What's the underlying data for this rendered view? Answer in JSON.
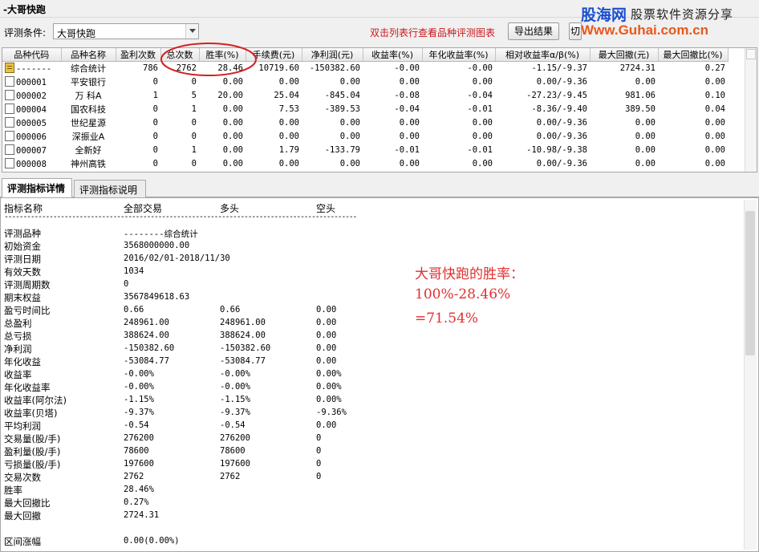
{
  "window": {
    "title": "-大哥快跑"
  },
  "watermark": {
    "brand": "股海网",
    "slogan": "股票软件资源分享",
    "url": "Www.Guhai.com.cn"
  },
  "toolbar": {
    "condition_label": "评测条件:",
    "condition_value": "大哥快跑",
    "hint": "双击列表行查看品种评测图表",
    "export_label": "导出结果",
    "extra_label": "切"
  },
  "table": {
    "columns": [
      "品种代码",
      "品种名称",
      "盈利次数",
      "总次数",
      "胜率(%)",
      "手续费(元)",
      "净利润(元)",
      "收益率(%)",
      "年化收益率(%)",
      "相对收益率α/β(%)",
      "最大回撤(元)",
      "最大回撤比(%)"
    ],
    "rows": [
      {
        "code": "-------",
        "name": "综合统计",
        "win": "786",
        "total": "2762",
        "rate": "28.46",
        "fee": "10719.60",
        "profit": "-150382.60",
        "ret": "-0.00",
        "annual": "-0.00",
        "rel": "-1.15/-9.37",
        "dd": "2724.31",
        "ddr": "0.27",
        "summary": true
      },
      {
        "code": "000001",
        "name": "平安银行",
        "win": "0",
        "total": "0",
        "rate": "0.00",
        "fee": "0.00",
        "profit": "0.00",
        "ret": "0.00",
        "annual": "0.00",
        "rel": "0.00/-9.36",
        "dd": "0.00",
        "ddr": "0.00"
      },
      {
        "code": "000002",
        "name": "万 科A",
        "win": "1",
        "total": "5",
        "rate": "20.00",
        "fee": "25.04",
        "profit": "-845.04",
        "ret": "-0.08",
        "annual": "-0.04",
        "rel": "-27.23/-9.45",
        "dd": "981.06",
        "ddr": "0.10"
      },
      {
        "code": "000004",
        "name": "国农科技",
        "win": "0",
        "total": "1",
        "rate": "0.00",
        "fee": "7.53",
        "profit": "-389.53",
        "ret": "-0.04",
        "annual": "-0.01",
        "rel": "-8.36/-9.40",
        "dd": "389.50",
        "ddr": "0.04"
      },
      {
        "code": "000005",
        "name": "世纪星源",
        "win": "0",
        "total": "0",
        "rate": "0.00",
        "fee": "0.00",
        "profit": "0.00",
        "ret": "0.00",
        "annual": "0.00",
        "rel": "0.00/-9.36",
        "dd": "0.00",
        "ddr": "0.00"
      },
      {
        "code": "000006",
        "name": "深振业A",
        "win": "0",
        "total": "0",
        "rate": "0.00",
        "fee": "0.00",
        "profit": "0.00",
        "ret": "0.00",
        "annual": "0.00",
        "rel": "0.00/-9.36",
        "dd": "0.00",
        "ddr": "0.00"
      },
      {
        "code": "000007",
        "name": "全新好",
        "win": "0",
        "total": "1",
        "rate": "0.00",
        "fee": "1.79",
        "profit": "-133.79",
        "ret": "-0.01",
        "annual": "-0.01",
        "rel": "-10.98/-9.38",
        "dd": "0.00",
        "ddr": "0.00"
      },
      {
        "code": "000008",
        "name": "神州高铁",
        "win": "0",
        "total": "0",
        "rate": "0.00",
        "fee": "0.00",
        "profit": "0.00",
        "ret": "0.00",
        "annual": "0.00",
        "rel": "0.00/-9.36",
        "dd": "0.00",
        "ddr": "0.00"
      }
    ]
  },
  "tabs": [
    {
      "label": "评测指标详情",
      "active": true
    },
    {
      "label": "评测指标说明",
      "active": false
    }
  ],
  "detail": {
    "headers": [
      "指标名称",
      "全部交易",
      "多头",
      "空头"
    ],
    "separator": "----------------------------------------------------------------------------------------------",
    "rows": [
      {
        "label": "评测品种",
        "all": "--------综合统计",
        "long": "",
        "short": ""
      },
      {
        "label": "初始资金",
        "all": "3568000000.00",
        "long": "",
        "short": ""
      },
      {
        "label": "评测日期",
        "all": "2016/02/01-2018/11/30",
        "long": "",
        "short": ""
      },
      {
        "label": "有效天数",
        "all": "1034",
        "long": "",
        "short": ""
      },
      {
        "label": "评测周期数",
        "all": "0",
        "long": "",
        "short": ""
      },
      {
        "label": "期末权益",
        "all": "3567849618.63",
        "long": "",
        "short": ""
      },
      {
        "label": "盈亏时间比",
        "all": "0.66",
        "long": "0.66",
        "short": "0.00"
      },
      {
        "label": "总盈利",
        "all": "248961.00",
        "long": "248961.00",
        "short": "0.00"
      },
      {
        "label": "总亏损",
        "all": "388624.00",
        "long": "388624.00",
        "short": "0.00"
      },
      {
        "label": "净利润",
        "all": "-150382.60",
        "long": "-150382.60",
        "short": "0.00"
      },
      {
        "label": "年化收益",
        "all": "-53084.77",
        "long": "-53084.77",
        "short": "0.00"
      },
      {
        "label": "收益率",
        "all": "-0.00%",
        "long": "-0.00%",
        "short": "0.00%"
      },
      {
        "label": "年化收益率",
        "all": "-0.00%",
        "long": "-0.00%",
        "short": "0.00%"
      },
      {
        "label": "收益率(阿尔法)",
        "all": "-1.15%",
        "long": "-1.15%",
        "short": "0.00%"
      },
      {
        "label": "收益率(贝塔)",
        "all": "-9.37%",
        "long": "-9.37%",
        "short": "-9.36%"
      },
      {
        "label": "平均利润",
        "all": "-0.54",
        "long": "-0.54",
        "short": "0.00"
      },
      {
        "label": "交易量(股/手)",
        "all": "276200",
        "long": "276200",
        "short": "0"
      },
      {
        "label": "盈利量(股/手)",
        "all": "78600",
        "long": "78600",
        "short": "0"
      },
      {
        "label": "亏损量(股/手)",
        "all": "197600",
        "long": "197600",
        "short": "0"
      },
      {
        "label": "交易次数",
        "all": "2762",
        "long": "2762",
        "short": "0"
      },
      {
        "label": "胜率",
        "all": "28.46%",
        "long": "",
        "short": ""
      },
      {
        "label": "最大回撤比",
        "all": "0.27%",
        "long": "",
        "short": ""
      },
      {
        "label": "最大回撤",
        "all": "2724.31",
        "long": "",
        "short": ""
      },
      {
        "label": "",
        "all": "",
        "long": "",
        "short": ""
      },
      {
        "label": "区间涨幅",
        "all": "0.00(0.00%)",
        "long": "",
        "short": ""
      }
    ]
  },
  "annotation": {
    "lines": [
      "大哥快跑的胜率：",
      "100%-28.46%",
      "=71.54%"
    ],
    "color": "#e03030",
    "highlight_color": "#d42020"
  }
}
